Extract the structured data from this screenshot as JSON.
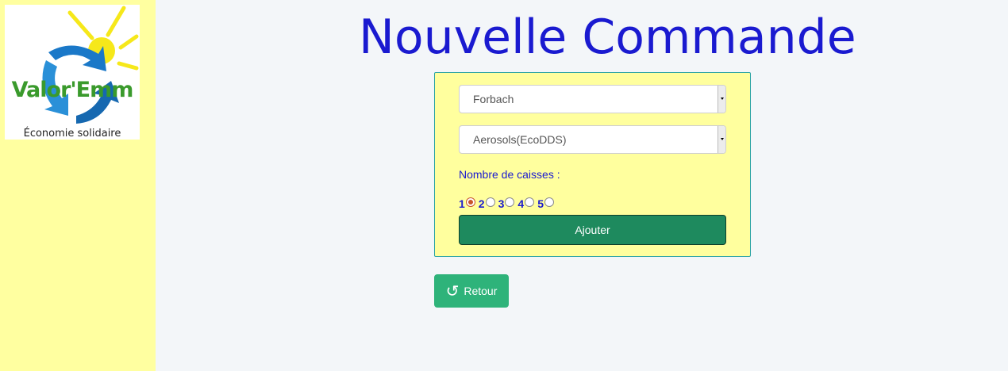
{
  "sidebar": {
    "logo": {
      "name": "Valor'Emm",
      "tagline": "Économie solidaire"
    }
  },
  "page": {
    "title": "Nouvelle Commande"
  },
  "form": {
    "site_select": {
      "value": "Forbach"
    },
    "product_select": {
      "value": "Aerosols(EcoDDS)"
    },
    "caisses_label": "Nombre de caisses :",
    "caisses_options": [
      "1",
      "2",
      "3",
      "4",
      "5"
    ],
    "caisses_selected": "1",
    "submit_label": "Ajouter"
  },
  "actions": {
    "back_label": "Retour",
    "back_icon": "refresh-icon"
  },
  "colors": {
    "title": "#1a1ad0",
    "sidebar_bg": "#ffffa0",
    "submit_bg": "#1e8a5e",
    "back_bg": "#2eb37a"
  }
}
